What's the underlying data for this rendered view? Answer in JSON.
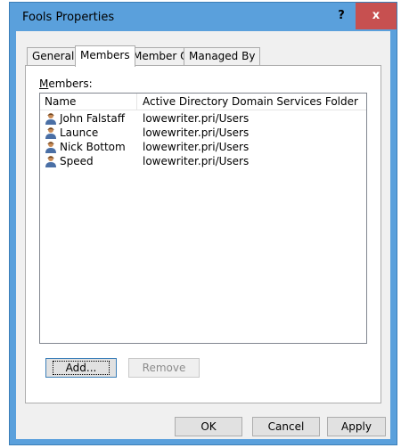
{
  "window": {
    "title": "Fools Properties",
    "help_label": "?",
    "close_label": "x"
  },
  "tabs": [
    {
      "label": "General",
      "active": false
    },
    {
      "label": "Members",
      "active": true
    },
    {
      "label": "Member Of",
      "active": false
    },
    {
      "label": "Managed By",
      "active": false
    }
  ],
  "members": {
    "label": "Members:",
    "columns": [
      "Name",
      "Active Directory Domain Services Folder"
    ],
    "rows": [
      {
        "name": "John Falstaff",
        "folder": "lowewriter.pri/Users"
      },
      {
        "name": "Launce",
        "folder": "lowewriter.pri/Users"
      },
      {
        "name": "Nick Bottom",
        "folder": "lowewriter.pri/Users"
      },
      {
        "name": "Speed",
        "folder": "lowewriter.pri/Users"
      }
    ],
    "add_label": "Add...",
    "remove_label": "Remove"
  },
  "footer": {
    "ok_label": "OK",
    "cancel_label": "Cancel",
    "apply_label": "Apply"
  },
  "icons": {
    "user": "user-icon",
    "help": "question-mark-icon",
    "close": "close-icon"
  },
  "colors": {
    "titlebar": "#5aa0dc",
    "close_button": "#c75050",
    "panel": "#f0f0f0"
  }
}
